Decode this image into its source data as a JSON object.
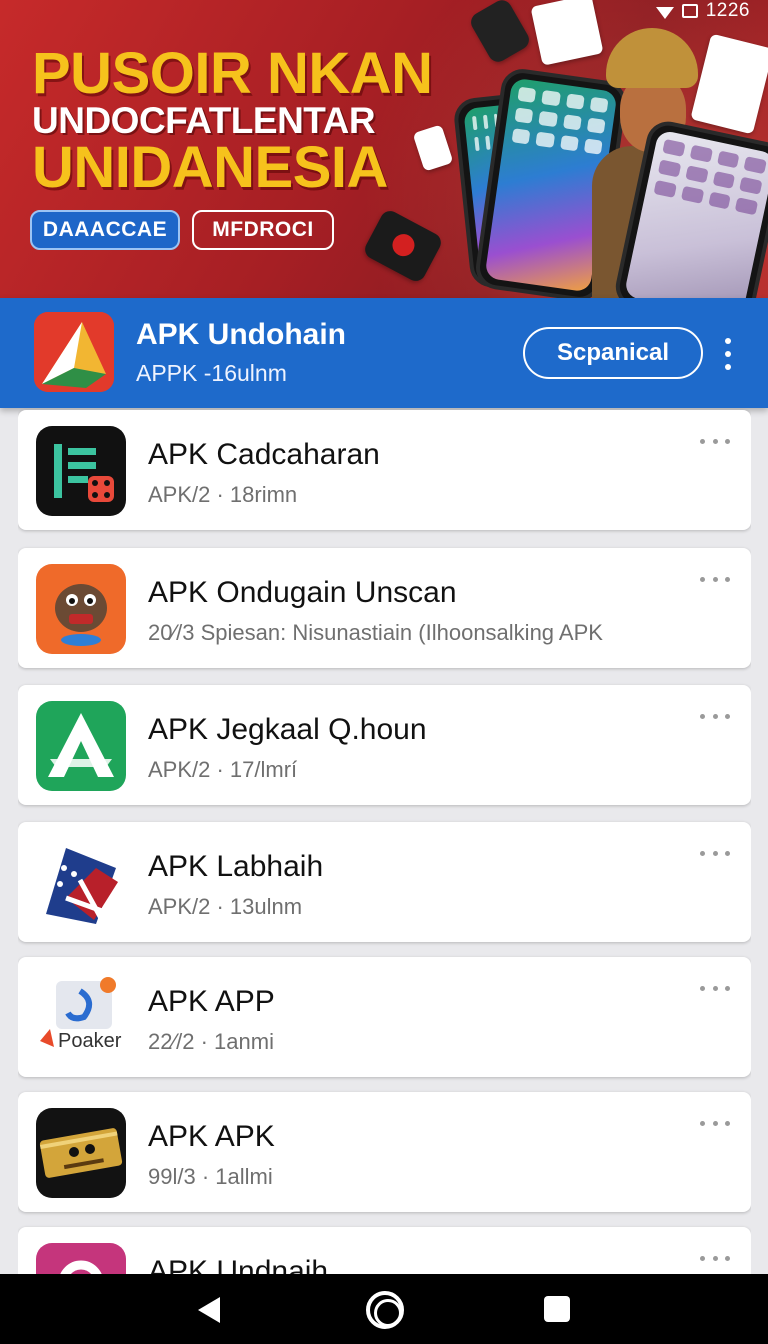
{
  "status_bar": {
    "time": "1226"
  },
  "banner": {
    "headline_1": "PUSOIR NKAN",
    "headline_2": "UNDOCFATLENTAR",
    "headline_3": "UNIDANESIA",
    "primary_button": "DAAACCAE",
    "secondary_button": "MFDROCI",
    "colors": {
      "background": "#a61f24",
      "headline": "#f6c21c",
      "primary_button": "#1e66c8"
    }
  },
  "appbar": {
    "title": "APK Undohain",
    "subtitle": "APPK -16ulnm",
    "action_button": "Scpanical",
    "color": "#1e6acb"
  },
  "apps": [
    {
      "name": "APK  Cadcaharan",
      "meta": "APK/2 · 18rimn",
      "icon": "list-dice-icon"
    },
    {
      "name": "APK  Ondugain Unscan",
      "meta": "20⁄/3  Spiesan: Nisunastiain (Ilhoonsalking APK",
      "icon": "monster-icon"
    },
    {
      "name": "APK  Jegkaal Q.houn",
      "meta": "APK/2 · 17/lmrí",
      "icon": "green-a-icon"
    },
    {
      "name": "APK  Labhaih",
      "meta": "APK/2 · 13ulnm",
      "icon": "flags-icon"
    },
    {
      "name": "APK  APP",
      "meta": "22⁄/2 · 1anmi",
      "icon": "poaker-icon",
      "icon_text": "Poaker"
    },
    {
      "name": "APK   APK",
      "meta": "99l/3 · 1allmi",
      "icon": "gold-badge-icon"
    },
    {
      "name": "APK  Undnaih",
      "meta": "",
      "icon": "pink-icon"
    }
  ]
}
